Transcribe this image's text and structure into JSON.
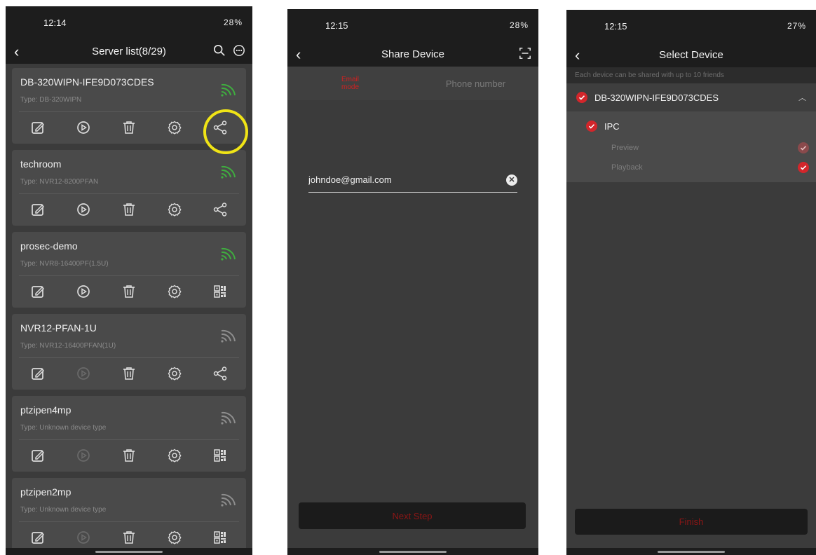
{
  "server_list": {
    "status_time": "12:14",
    "status_right": "28%",
    "title": "Server list(8/29)",
    "devices": [
      {
        "name": "DB-320WIPN-IFE9D073CDES",
        "type": "Type: DB-320WIPN",
        "online": true,
        "last_icon": "share-icon",
        "playback_enabled": true
      },
      {
        "name": "techroom",
        "type": "Type: NVR12-8200PFAN",
        "online": true,
        "last_icon": "share-icon",
        "playback_enabled": true
      },
      {
        "name": "prosec-demo",
        "type": "Type: NVR8-16400PF(1.5U)",
        "online": true,
        "last_icon": "qr-code-icon",
        "playback_enabled": true
      },
      {
        "name": "NVR12-PFAN-1U",
        "type": "Type: NVR12-16400PFAN(1U)",
        "online": false,
        "last_icon": "share-icon",
        "playback_enabled": false
      },
      {
        "name": "ptzipen4mp",
        "type": "Type: Unknown device type",
        "online": false,
        "last_icon": "qr-code-icon",
        "playback_enabled": false
      },
      {
        "name": "ptzipen2mp",
        "type": "Type: Unknown device type",
        "online": false,
        "last_icon": "qr-code-icon",
        "playback_enabled": false
      }
    ]
  },
  "share_device": {
    "status_time": "12:15",
    "status_right": "28%",
    "title": "Share Device",
    "tab_email": "Email\nmode",
    "tab_phone": "Phone number",
    "email_value": "johndoe@gmail.com",
    "next_label": "Next Step"
  },
  "select_device": {
    "status_time": "12:15",
    "status_right": "27%",
    "title": "Select Device",
    "info": "Each device can be shared with up to 10 friends",
    "device_name": "DB-320WIPN-IFE9D073CDES",
    "channel": "IPC",
    "permissions": [
      "Preview",
      "Playback"
    ],
    "finish_label": "Finish"
  },
  "colors": {
    "accent_red": "#d3262b",
    "online_green": "#3fae3f",
    "highlight_yellow": "#f0e416"
  }
}
